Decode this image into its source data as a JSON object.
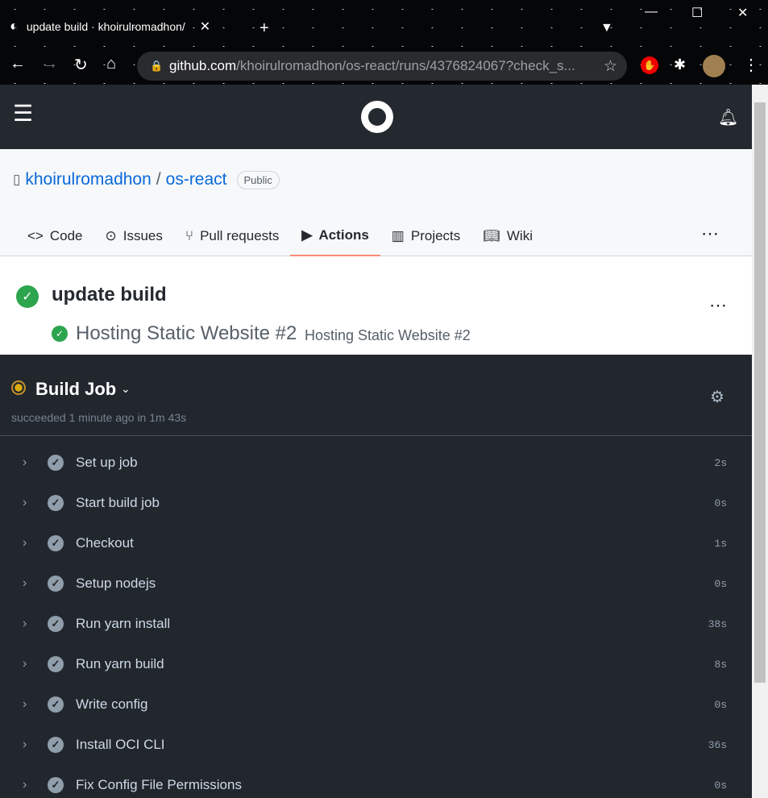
{
  "browser": {
    "tab_title": "update build · khoirulromadhon/",
    "url_host": "github.com",
    "url_path": "/khoirulromadhon/os-react/runs/4376824067?check_s..."
  },
  "repo": {
    "owner": "khoirulromadhon",
    "sep": "/",
    "name": "os-react",
    "visibility": "Public"
  },
  "tabs": [
    "Code",
    "Issues",
    "Pull requests",
    "Actions",
    "Projects",
    "Wiki"
  ],
  "run": {
    "title": "update build",
    "workflow": "Hosting Static Website",
    "number": "#2",
    "workflow_dup": "Hosting Static Website #2"
  },
  "job": {
    "name": "Build Job",
    "status": "succeeded 1 minute ago in 1m 43s"
  },
  "steps": [
    {
      "name": "Set up job",
      "time": "2s"
    },
    {
      "name": "Start build job",
      "time": "0s"
    },
    {
      "name": "Checkout",
      "time": "1s"
    },
    {
      "name": "Setup nodejs",
      "time": "0s"
    },
    {
      "name": "Run yarn install",
      "time": "38s"
    },
    {
      "name": "Run yarn build",
      "time": "8s"
    },
    {
      "name": "Write config",
      "time": "0s"
    },
    {
      "name": "Install OCI CLI",
      "time": "36s"
    },
    {
      "name": "Fix Config File Permissions",
      "time": "0s"
    }
  ]
}
